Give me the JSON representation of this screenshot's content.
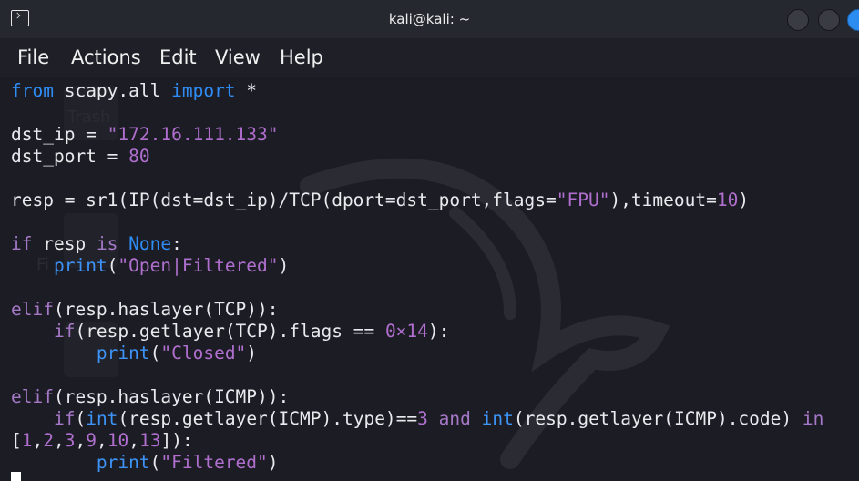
{
  "window": {
    "title": "kali@kali: ~",
    "icon": "terminal-icon"
  },
  "menu": {
    "items": [
      "File",
      "Actions",
      "Edit",
      "View",
      "Help"
    ]
  },
  "desktop_watermark": {
    "label_top": "Trash",
    "label_mid": "Fi"
  },
  "code": {
    "l1": [
      [
        "kw",
        "from"
      ],
      [
        "",
        " scapy.all "
      ],
      [
        "kw",
        "import"
      ],
      [
        "",
        " *"
      ]
    ],
    "l2": [],
    "l3": [
      [
        "",
        "dst_ip = "
      ],
      [
        "str",
        "\"172.16.111.133\""
      ]
    ],
    "l4": [
      [
        "",
        "dst_port = "
      ],
      [
        "num",
        "80"
      ]
    ],
    "l5": [],
    "l6": [
      [
        "",
        "resp = sr1(IP(dst=dst_ip)/TCP(dport=dst_port,flags="
      ],
      [
        "str",
        "\"FPU\""
      ],
      [
        "",
        "),timeout="
      ],
      [
        "num",
        "10"
      ],
      [
        "",
        ")"
      ]
    ],
    "l7": [],
    "l8": [
      [
        "kw2",
        "if"
      ],
      [
        "",
        " resp "
      ],
      [
        "kw2",
        "is"
      ],
      [
        "",
        " "
      ],
      [
        "kw",
        "None"
      ],
      [
        "",
        ":"
      ]
    ],
    "l9": [
      [
        "",
        "    "
      ],
      [
        "fn",
        "print"
      ],
      [
        "",
        "("
      ],
      [
        "str",
        "\"Open|Filtered\""
      ],
      [
        "",
        ")"
      ]
    ],
    "l10": [],
    "l11": [
      [
        "kw2",
        "elif"
      ],
      [
        "",
        "(resp.haslayer(TCP)):"
      ]
    ],
    "l12": [
      [
        "",
        "    "
      ],
      [
        "kw2",
        "if"
      ],
      [
        "",
        "(resp.getlayer(TCP).flags "
      ],
      [
        "",
        "=="
      ],
      [
        "",
        " "
      ],
      [
        "num",
        "0×14"
      ],
      [
        "",
        "):"
      ]
    ],
    "l13": [
      [
        "",
        "        "
      ],
      [
        "fn",
        "print"
      ],
      [
        "",
        "("
      ],
      [
        "str",
        "\"Closed\""
      ],
      [
        "",
        ")"
      ]
    ],
    "l14": [],
    "l15": [
      [
        "kw2",
        "elif"
      ],
      [
        "",
        "(resp.haslayer(ICMP)):"
      ]
    ],
    "l16": [
      [
        "",
        "    "
      ],
      [
        "kw2",
        "if"
      ],
      [
        "",
        "("
      ],
      [
        "fn",
        "int"
      ],
      [
        "",
        "(resp.getlayer(ICMP).type)"
      ],
      [
        "",
        "=="
      ],
      [
        "num",
        "3"
      ],
      [
        "",
        " "
      ],
      [
        "kw2",
        "and"
      ],
      [
        "",
        " "
      ],
      [
        "fn",
        "int"
      ],
      [
        "",
        "(resp.getlayer(ICMP).code) "
      ],
      [
        "kw2",
        "in"
      ]
    ],
    "l17": [
      [
        "",
        "["
      ],
      [
        "num",
        "1"
      ],
      [
        "",
        ","
      ],
      [
        "num",
        "2"
      ],
      [
        "",
        ","
      ],
      [
        "num",
        "3"
      ],
      [
        "",
        ","
      ],
      [
        "num",
        "9"
      ],
      [
        "",
        ","
      ],
      [
        "num",
        "10"
      ],
      [
        "",
        ","
      ],
      [
        "num",
        "13"
      ],
      [
        "",
        "]):"
      ]
    ],
    "l18": [
      [
        "",
        "        "
      ],
      [
        "fn",
        "print"
      ],
      [
        "",
        "("
      ],
      [
        "str",
        "\"Filtered\""
      ],
      [
        "",
        ")"
      ]
    ]
  },
  "colors": {
    "keyword_blue": "#2f8cf5",
    "keyword_purple": "#a678c8",
    "string_purple": "#b06fcf",
    "text": "#e9e9ee",
    "background": "#1c1d24"
  }
}
